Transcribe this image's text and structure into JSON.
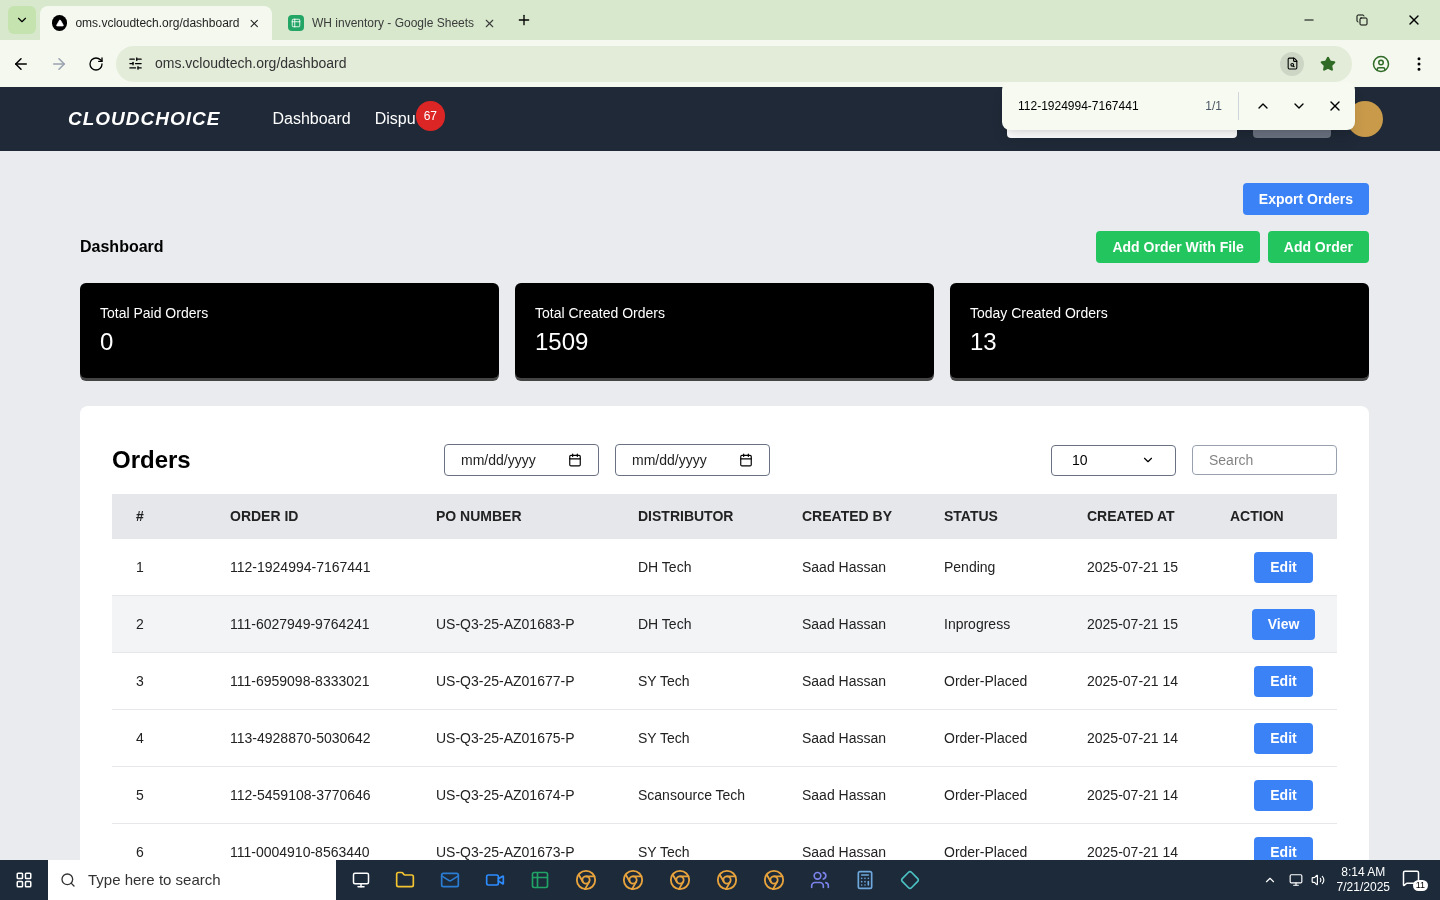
{
  "browser": {
    "tabs": [
      {
        "title": "oms.vcloudtech.org/dashboard",
        "selected": true,
        "kind": "site"
      },
      {
        "title": "WH inventory - Google Sheets",
        "selected": false,
        "kind": "sheets"
      }
    ],
    "url": "oms.vcloudtech.org/dashboard",
    "find_bar": {
      "query": "112-1924994-7167441",
      "count": "1/1"
    }
  },
  "nav": {
    "logo": "CLOUDCHOICE",
    "links": [
      {
        "label": "Dashboard"
      },
      {
        "label": "Dispu",
        "badge": "67"
      }
    ]
  },
  "page": {
    "title": "Dashboard",
    "buttons": [
      {
        "label": "Export Orders",
        "kind": "primary"
      },
      {
        "label": "Add Order With File",
        "kind": "success"
      },
      {
        "label": "Add Order",
        "kind": "success"
      }
    ],
    "stats": [
      {
        "label": "Total Paid Orders",
        "value": "0"
      },
      {
        "label": "Total Created Orders",
        "value": "1509"
      },
      {
        "label": "Today Created Orders",
        "value": "13"
      }
    ]
  },
  "orders": {
    "title": "Orders",
    "date_from": {
      "placeholder": "mm/dd/yyyy"
    },
    "date_to": {
      "placeholder": "mm/dd/yyyy"
    },
    "page_size": "10",
    "search": {
      "placeholder": "Search"
    },
    "columns": [
      "#",
      "ORDER ID",
      "PO NUMBER",
      "DISTRIBUTOR",
      "CREATED BY",
      "STATUS",
      "CREATED AT",
      "ACTION"
    ],
    "rows": [
      {
        "cells": [
          "1",
          "112-1924994-7167441",
          "",
          "DH Tech",
          "Saad Hassan",
          "Pending",
          "2025-07-21 15"
        ],
        "action": "Edit",
        "selected": false
      },
      {
        "cells": [
          "2",
          "111-6027949-9764241",
          "US-Q3-25-AZ01683-P",
          "DH Tech",
          "Saad Hassan",
          "Inprogress",
          "2025-07-21 15"
        ],
        "action": "View",
        "selected": true
      },
      {
        "cells": [
          "3",
          "111-6959098-8333021",
          "US-Q3-25-AZ01677-P",
          "SY Tech",
          "Saad Hassan",
          "Order-Placed",
          "2025-07-21 14"
        ],
        "action": "Edit",
        "selected": false
      },
      {
        "cells": [
          "4",
          "113-4928870-5030642",
          "US-Q3-25-AZ01675-P",
          "SY Tech",
          "Saad Hassan",
          "Order-Placed",
          "2025-07-21 14"
        ],
        "action": "Edit",
        "selected": false
      },
      {
        "cells": [
          "5",
          "112-5459108-3770646",
          "US-Q3-25-AZ01674-P",
          "Scansource Tech",
          "Saad Hassan",
          "Order-Placed",
          "2025-07-21 14"
        ],
        "action": "Edit",
        "selected": false
      },
      {
        "cells": [
          "6",
          "111-0004910-8563440",
          "US-Q3-25-AZ01673-P",
          "SY Tech",
          "Saad Hassan",
          "Order-Placed",
          "2025-07-21 14"
        ],
        "action": "Edit",
        "selected": false
      }
    ]
  },
  "taskbar": {
    "search": {
      "placeholder": "Type here to search"
    },
    "time": "8:14 AM",
    "date": "7/21/2025",
    "notifications": "11"
  }
}
